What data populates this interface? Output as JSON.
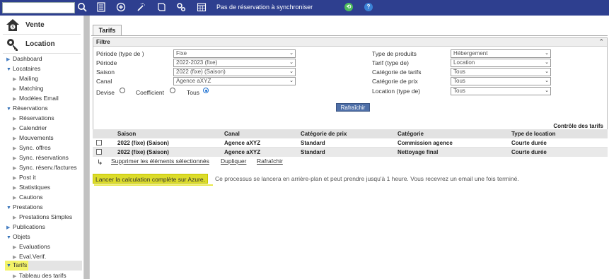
{
  "topbar": {
    "search_placeholder": "",
    "sync_status": "Pas de réservation à synchroniser",
    "icons": [
      "search-icon",
      "list-icon",
      "add-icon",
      "magic-wand-icon",
      "book-icon",
      "gears-icon",
      "calendar-icon",
      "sync-icon",
      "help-icon"
    ],
    "sync_symbol": "⟲",
    "help_symbol": "?",
    "accent": "#2e3f8f"
  },
  "sidebar": {
    "modules": [
      {
        "label": "Vente",
        "icon": "house-dollar-icon"
      },
      {
        "label": "Location",
        "icon": "key-icon"
      }
    ],
    "items": [
      {
        "label": "Dashboard"
      },
      {
        "label": "Locataires"
      },
      {
        "label": "Mailing"
      },
      {
        "label": "Matching"
      },
      {
        "label": "Modèles Email"
      },
      {
        "label": "Réservations"
      },
      {
        "label": "Réservations"
      },
      {
        "label": "Calendrier"
      },
      {
        "label": "Mouvements"
      },
      {
        "label": "Sync. offres"
      },
      {
        "label": "Sync. réservations"
      },
      {
        "label": "Sync. réserv./factures"
      },
      {
        "label": "Post it"
      },
      {
        "label": "Statistiques"
      },
      {
        "label": "Cautions"
      },
      {
        "label": "Prestations"
      },
      {
        "label": "Prestations Simples"
      },
      {
        "label": "Publications"
      },
      {
        "label": "Objets"
      },
      {
        "label": "Evaluations"
      },
      {
        "label": "Eval.Verif."
      },
      {
        "label": "Tarifs"
      },
      {
        "label": "Tableau des tarifs"
      }
    ]
  },
  "main": {
    "tab": "Tarifs",
    "filter": {
      "title": "Filtre",
      "collapse_symbol": "⌃",
      "left": [
        {
          "label": "Période (type de )",
          "value": "Fixe"
        },
        {
          "label": "Période",
          "value": "2022-2023 (fixe)"
        },
        {
          "label": "Saison",
          "value": "2022 (fixe) (Saison)"
        },
        {
          "label": "Canal",
          "value": "Agence aXYZ"
        }
      ],
      "right": [
        {
          "label": "Type de produits",
          "value": "Hébergement"
        },
        {
          "label": "Tarif (type de)",
          "value": "Location"
        },
        {
          "label": "Catégorie de tarifs",
          "value": "Tous"
        },
        {
          "label": "Catégorie de prix",
          "value": "Tous"
        },
        {
          "label": "Location (type de)",
          "value": "Tous"
        }
      ],
      "radios": {
        "devise": "Devise",
        "coefficient": "Coefficient",
        "tous": "Tous",
        "selected": "tous"
      },
      "refresh_label": "Rafraîchir"
    },
    "control_title": "Contrôle des tarifs",
    "table": {
      "headers": [
        "Saison",
        "Canal",
        "Catégorie de prix",
        "Catégorie",
        "Type de location"
      ],
      "rows": [
        [
          "2022 (fixe) (Saison)",
          "Agence aXYZ",
          "Standard",
          "Commission agence",
          "Courte durée"
        ],
        [
          "2022 (fixe) (Saison)",
          "Agence aXYZ",
          "Standard",
          "Nettoyage final",
          "Courte durée"
        ]
      ]
    },
    "actions": {
      "corner": "↳",
      "delete": "Supprimer les éléments sélectionnés",
      "duplicate": "Dupliquer",
      "refresh": "Rafraîchir"
    },
    "azure": {
      "button": "Lancer la calculation complète sur Azure.",
      "note": "Ce processus se lancera en arrière-plan et peut prendre jusqu'à 1 heure. Vous recevrez un email une fois terminé."
    }
  }
}
